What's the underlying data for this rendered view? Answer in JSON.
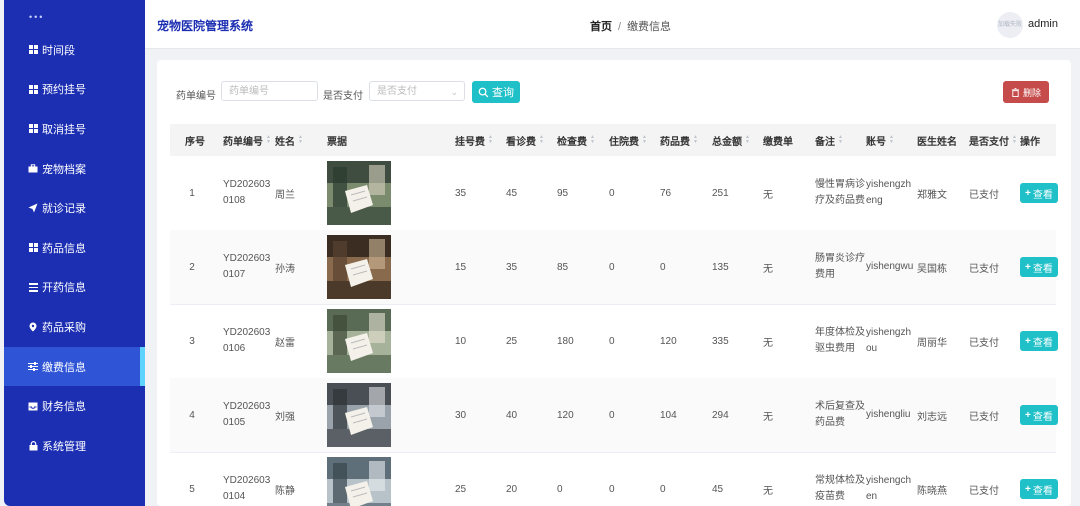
{
  "sidebar": {
    "items": [
      {
        "label": "时间段",
        "icon": "grid-icon"
      },
      {
        "label": "预约挂号",
        "icon": "grid-icon"
      },
      {
        "label": "取消挂号",
        "icon": "grid-icon"
      },
      {
        "label": "宠物档案",
        "icon": "briefcase-icon"
      },
      {
        "label": "就诊记录",
        "icon": "send-icon"
      },
      {
        "label": "药品信息",
        "icon": "grid-icon"
      },
      {
        "label": "开药信息",
        "icon": "list-icon"
      },
      {
        "label": "药品采购",
        "icon": "map-pin-icon"
      },
      {
        "label": "缴费信息",
        "icon": "sliders-icon",
        "active": true
      },
      {
        "label": "财务信息",
        "icon": "inbox-icon"
      },
      {
        "label": "系统管理",
        "icon": "lock-icon"
      }
    ]
  },
  "header": {
    "app_title": "宠物医院管理系统",
    "breadcrumb_home": "首页",
    "breadcrumb_sep": "/",
    "breadcrumb_current": "缴费信息",
    "avatar_text": "加载失败",
    "username": "admin"
  },
  "toolbar": {
    "order_label": "药单编号",
    "order_placeholder": "药单编号",
    "paid_label": "是否支付",
    "paid_placeholder": "是否支付",
    "query_label": "查询",
    "delete_label": "删除"
  },
  "table": {
    "headers": [
      "序号",
      "药单编号",
      "姓名",
      "票据",
      "挂号费",
      "看诊费",
      "检查费",
      "住院费",
      "药品费",
      "总金额",
      "缴费单",
      "备注",
      "账号",
      "医生姓名",
      "是否支付",
      "操作"
    ],
    "view_label": "查看",
    "rows": [
      {
        "idx": "1",
        "order": "YD2026030108",
        "name": "周兰",
        "reg": "35",
        "consult": "45",
        "exam": "95",
        "hosp": "0",
        "drug": "76",
        "total": "251",
        "bill": "无",
        "note": "慢性胃病诊疗及药品费",
        "account": "yishengzheng",
        "doctor": "郑雅文",
        "paid": "已支付"
      },
      {
        "idx": "2",
        "order": "YD2026030107",
        "name": "孙涛",
        "reg": "15",
        "consult": "35",
        "exam": "85",
        "hosp": "0",
        "drug": "0",
        "total": "135",
        "bill": "无",
        "note": "肠胃炎诊疗费用",
        "account": "yishengwu",
        "doctor": "吴国栋",
        "paid": "已支付"
      },
      {
        "idx": "3",
        "order": "YD2026030106",
        "name": "赵雷",
        "reg": "10",
        "consult": "25",
        "exam": "180",
        "hosp": "0",
        "drug": "120",
        "total": "335",
        "bill": "无",
        "note": "年度体检及驱虫费用",
        "account": "yishengzhou",
        "doctor": "周丽华",
        "paid": "已支付"
      },
      {
        "idx": "4",
        "order": "YD2026030105",
        "name": "刘强",
        "reg": "30",
        "consult": "40",
        "exam": "120",
        "hosp": "0",
        "drug": "104",
        "total": "294",
        "bill": "无",
        "note": "术后复查及药品费",
        "account": "yishengliu",
        "doctor": "刘志远",
        "paid": "已支付"
      },
      {
        "idx": "5",
        "order": "YD2026030104",
        "name": "陈静",
        "reg": "25",
        "consult": "20",
        "exam": "0",
        "hosp": "0",
        "drug": "0",
        "total": "45",
        "bill": "无",
        "note": "常规体检及疫苗费",
        "account": "yishengchen",
        "doctor": "陈晓燕",
        "paid": "已支付"
      }
    ]
  },
  "colors": {
    "sidebar_bg": "#1c2fb3",
    "active_item": "#2f54d6",
    "accent": "#1fc0c8",
    "danger": "#c64b4b"
  }
}
